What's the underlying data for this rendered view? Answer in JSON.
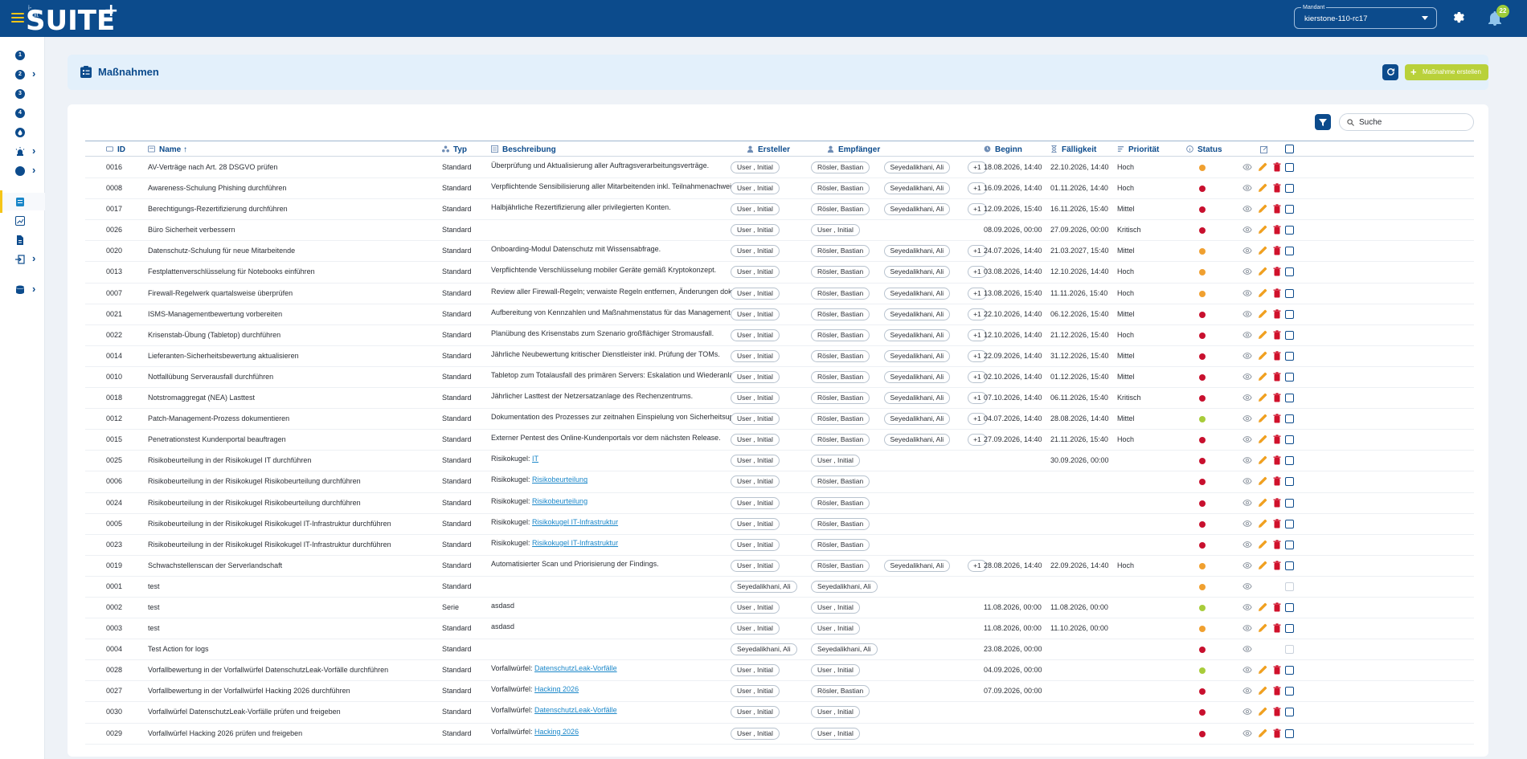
{
  "app": {
    "logo_small": "i-doit",
    "logo_text": "SUITE",
    "logo_plus": "+",
    "mandant_label": "Mandant",
    "mandant_value": "kierstone-110-rc17",
    "notification_count": "22"
  },
  "sidebar": {
    "items": [
      {
        "label": "1",
        "icon": "number-circle",
        "chevron": false
      },
      {
        "label": "2",
        "icon": "number-circle",
        "chevron": true
      },
      {
        "label": "3",
        "icon": "number-circle",
        "chevron": false
      },
      {
        "label": "4",
        "icon": "number-circle",
        "chevron": false
      },
      {
        "label": "",
        "icon": "flame-icon",
        "chevron": false
      },
      {
        "label": "",
        "icon": "alarm-light-icon",
        "chevron": true
      },
      {
        "label": "",
        "icon": "number-circle",
        "chevron": true
      },
      {
        "label": "",
        "icon": "clipboard-list-icon",
        "chevron": false,
        "active": true
      },
      {
        "label": "",
        "icon": "chart-icon",
        "chevron": false
      },
      {
        "label": "",
        "icon": "document-icon",
        "chevron": false
      },
      {
        "label": "",
        "icon": "login-icon",
        "chevron": true
      },
      {
        "label": "",
        "icon": "database-icon",
        "chevron": true
      }
    ]
  },
  "header": {
    "title": "Maßnahmen",
    "create_label": "Maßnahme erstellen"
  },
  "search": {
    "placeholder": "Suche"
  },
  "columns": {
    "id": "ID",
    "name": "Name",
    "name_sort": "↑",
    "typ": "Typ",
    "beschreibung": "Beschreibung",
    "ersteller": "Ersteller",
    "empfaenger": "Empfänger",
    "beginn": "Beginn",
    "faelligkeit": "Fälligkeit",
    "prioritaet": "Priorität",
    "status": "Status"
  },
  "colors": {
    "primary": "#0c4b8c",
    "accent": "#b9d13a",
    "status_red": "#c8102e",
    "status_orange": "#f0a030",
    "status_green": "#a8cc3a",
    "edit": "#f0a020",
    "delete": "#d0112b"
  },
  "rows": [
    {
      "id": "0016",
      "name": "AV-Verträge nach Art. 28 DSGVO prüfen",
      "typ": "Standard",
      "desc": "Überprüfung und Aktualisierung aller Auftragsverarbeitungsverträge.",
      "desc_link": "",
      "ersteller": "User , Initial",
      "empf": [
        "Rösler, Bastian",
        "Seyedalikhani, Ali",
        "+1"
      ],
      "beginn": "18.08.2026, 14:40",
      "faellig": "22.10.2026, 14:40",
      "prio": "Hoch",
      "status": "orange",
      "actions": "full"
    },
    {
      "id": "0008",
      "name": "Awareness-Schulung Phishing durchführen",
      "typ": "Standard",
      "desc": "Verpflichtende Sensibilisierung aller Mitarbeitenden inkl. Teilnahmenachweis.",
      "desc_link": "",
      "ersteller": "User , Initial",
      "empf": [
        "Rösler, Bastian",
        "Seyedalikhani, Ali",
        "+1"
      ],
      "beginn": "16.09.2026, 14:40",
      "faellig": "01.11.2026, 14:40",
      "prio": "Hoch",
      "status": "red",
      "actions": "full"
    },
    {
      "id": "0017",
      "name": "Berechtigungs-Rezertifizierung durchführen",
      "typ": "Standard",
      "desc": "Halbjährliche Rezertifizierung aller privilegierten Konten.",
      "desc_link": "",
      "ersteller": "User , Initial",
      "empf": [
        "Rösler, Bastian",
        "Seyedalikhani, Ali",
        "+1"
      ],
      "beginn": "12.09.2026, 15:40",
      "faellig": "16.11.2026, 15:40",
      "prio": "Mittel",
      "status": "red",
      "actions": "full"
    },
    {
      "id": "0026",
      "name": "Büro Sicherheit verbessern",
      "typ": "Standard",
      "desc": "",
      "desc_link": "",
      "ersteller": "User , Initial",
      "empf": [
        "User , Initial"
      ],
      "beginn": "08.09.2026, 00:00",
      "faellig": "27.09.2026, 00:00",
      "prio": "Kritisch",
      "status": "red",
      "actions": "full"
    },
    {
      "id": "0020",
      "name": "Datenschutz-Schulung für neue Mitarbeitende",
      "typ": "Standard",
      "desc": "Onboarding-Modul Datenschutz mit Wissensabfrage.",
      "desc_link": "",
      "ersteller": "User , Initial",
      "empf": [
        "Rösler, Bastian",
        "Seyedalikhani, Ali",
        "+1"
      ],
      "beginn": "24.07.2026, 14:40",
      "faellig": "21.03.2027, 15:40",
      "prio": "Mittel",
      "status": "orange",
      "actions": "full"
    },
    {
      "id": "0013",
      "name": "Festplattenverschlüsselung für Notebooks einführen",
      "typ": "Standard",
      "desc": "Verpflichtende Verschlüsselung mobiler Geräte gemäß Kryptokonzept.",
      "desc_link": "",
      "ersteller": "User , Initial",
      "empf": [
        "Rösler, Bastian",
        "Seyedalikhani, Ali",
        "+1"
      ],
      "beginn": "03.08.2026, 14:40",
      "faellig": "12.10.2026, 14:40",
      "prio": "Hoch",
      "status": "orange",
      "actions": "full"
    },
    {
      "id": "0007",
      "name": "Firewall-Regelwerk quartalsweise überprüfen",
      "typ": "Standard",
      "desc": "Review aller Firewall-Regeln; verwaiste Regeln entfernen, Änderungen dokumentieren.",
      "desc_link": "",
      "ersteller": "User , Initial",
      "empf": [
        "Rösler, Bastian",
        "Seyedalikhani, Ali",
        "+1"
      ],
      "beginn": "13.08.2026, 15:40",
      "faellig": "11.11.2026, 15:40",
      "prio": "Hoch",
      "status": "orange",
      "actions": "full"
    },
    {
      "id": "0021",
      "name": "ISMS-Managementbewertung vorbereiten",
      "typ": "Standard",
      "desc": "Aufbereitung von Kennzahlen und Maßnahmenstatus für das Management-Review.",
      "desc_link": "",
      "ersteller": "User , Initial",
      "empf": [
        "Rösler, Bastian",
        "Seyedalikhani, Ali",
        "+1"
      ],
      "beginn": "22.10.2026, 14:40",
      "faellig": "06.12.2026, 15:40",
      "prio": "Mittel",
      "status": "red",
      "actions": "full"
    },
    {
      "id": "0022",
      "name": "Krisenstab-Übung (Tabletop) durchführen",
      "typ": "Standard",
      "desc": "Planübung des Krisenstabs zum Szenario großflächiger Stromausfall.",
      "desc_link": "",
      "ersteller": "User , Initial",
      "empf": [
        "Rösler, Bastian",
        "Seyedalikhani, Ali",
        "+1"
      ],
      "beginn": "12.10.2026, 14:40",
      "faellig": "21.12.2026, 15:40",
      "prio": "Hoch",
      "status": "red",
      "actions": "full"
    },
    {
      "id": "0014",
      "name": "Lieferanten-Sicherheitsbewertung aktualisieren",
      "typ": "Standard",
      "desc": "Jährliche Neubewertung kritischer Dienstleister inkl. Prüfung der TOMs.",
      "desc_link": "",
      "ersteller": "User , Initial",
      "empf": [
        "Rösler, Bastian",
        "Seyedalikhani, Ali",
        "+1"
      ],
      "beginn": "22.09.2026, 14:40",
      "faellig": "31.12.2026, 15:40",
      "prio": "Mittel",
      "status": "red",
      "actions": "full"
    },
    {
      "id": "0010",
      "name": "Notfallübung Serverausfall durchführen",
      "typ": "Standard",
      "desc": "Tabletop zum Totalausfall des primären Servers: Eskalation und Wiederanlauf.",
      "desc_link": "",
      "ersteller": "User , Initial",
      "empf": [
        "Rösler, Bastian",
        "Seyedalikhani, Ali",
        "+1"
      ],
      "beginn": "02.10.2026, 14:40",
      "faellig": "01.12.2026, 15:40",
      "prio": "Mittel",
      "status": "red",
      "actions": "full"
    },
    {
      "id": "0018",
      "name": "Notstromaggregat (NEA) Lasttest",
      "typ": "Standard",
      "desc": "Jährlicher Lasttest der Netzersatzanlage des Rechenzentrums.",
      "desc_link": "",
      "ersteller": "User , Initial",
      "empf": [
        "Rösler, Bastian",
        "Seyedalikhani, Ali",
        "+1"
      ],
      "beginn": "07.10.2026, 14:40",
      "faellig": "06.11.2026, 15:40",
      "prio": "Kritisch",
      "status": "red",
      "actions": "full"
    },
    {
      "id": "0012",
      "name": "Patch-Management-Prozess dokumentieren",
      "typ": "Standard",
      "desc": "Dokumentation des Prozesses zur zeitnahen Einspielung von Sicherheitsupdates.",
      "desc_link": "",
      "ersteller": "User , Initial",
      "empf": [
        "Rösler, Bastian",
        "Seyedalikhani, Ali",
        "+1"
      ],
      "beginn": "04.07.2026, 14:40",
      "faellig": "28.08.2026, 14:40",
      "prio": "Mittel",
      "status": "green",
      "actions": "full"
    },
    {
      "id": "0015",
      "name": "Penetrationstest Kundenportal beauftragen",
      "typ": "Standard",
      "desc": "Externer Pentest des Online-Kundenportals vor dem nächsten Release.",
      "desc_link": "",
      "ersteller": "User , Initial",
      "empf": [
        "Rösler, Bastian",
        "Seyedalikhani, Ali",
        "+1"
      ],
      "beginn": "27.09.2026, 14:40",
      "faellig": "21.11.2026, 15:40",
      "prio": "Hoch",
      "status": "red",
      "actions": "full"
    },
    {
      "id": "0025",
      "name": "Risikobeurteilung in der Risikokugel IT durchführen",
      "typ": "Standard",
      "desc": "Risikokugel: ",
      "desc_link": "IT",
      "ersteller": "User , Initial",
      "empf": [
        "User , Initial"
      ],
      "beginn": "",
      "faellig": "30.09.2026, 00:00",
      "prio": "",
      "status": "red",
      "actions": "full"
    },
    {
      "id": "0006",
      "name": "Risikobeurteilung in der Risikokugel Risikobeurteilung durchführen",
      "typ": "Standard",
      "desc": "Risikokugel: ",
      "desc_link": "Risikobeurteilung",
      "ersteller": "User , Initial",
      "empf": [
        "Rösler, Bastian"
      ],
      "beginn": "",
      "faellig": "",
      "prio": "",
      "status": "red",
      "actions": "full"
    },
    {
      "id": "0024",
      "name": "Risikobeurteilung in der Risikokugel Risikobeurteilung durchführen",
      "typ": "Standard",
      "desc": "Risikokugel: ",
      "desc_link": "Risikobeurteilung",
      "ersteller": "User , Initial",
      "empf": [
        "Rösler, Bastian"
      ],
      "beginn": "",
      "faellig": "",
      "prio": "",
      "status": "red",
      "actions": "full"
    },
    {
      "id": "0005",
      "name": "Risikobeurteilung in der Risikokugel Risikokugel IT-Infrastruktur durchführen",
      "typ": "Standard",
      "desc": "Risikokugel: ",
      "desc_link": "Risikokugel IT-Infrastruktur",
      "ersteller": "User , Initial",
      "empf": [
        "Rösler, Bastian"
      ],
      "beginn": "",
      "faellig": "",
      "prio": "",
      "status": "red",
      "actions": "full"
    },
    {
      "id": "0023",
      "name": "Risikobeurteilung in der Risikokugel Risikokugel IT-Infrastruktur durchführen",
      "typ": "Standard",
      "desc": "Risikokugel: ",
      "desc_link": "Risikokugel IT-Infrastruktur",
      "ersteller": "User , Initial",
      "empf": [
        "Rösler, Bastian"
      ],
      "beginn": "",
      "faellig": "",
      "prio": "",
      "status": "red",
      "actions": "full"
    },
    {
      "id": "0019",
      "name": "Schwachstellenscan der Serverlandschaft",
      "typ": "Standard",
      "desc": "Automatisierter Scan und Priorisierung der Findings.",
      "desc_link": "",
      "ersteller": "User , Initial",
      "empf": [
        "Rösler, Bastian",
        "Seyedalikhani, Ali",
        "+1"
      ],
      "beginn": "28.08.2026, 14:40",
      "faellig": "22.09.2026, 14:40",
      "prio": "Hoch",
      "status": "orange",
      "actions": "full"
    },
    {
      "id": "0001",
      "name": "test",
      "typ": "Standard",
      "desc": "",
      "desc_link": "",
      "ersteller": "Seyedalikhani, Ali",
      "empf": [
        "Seyedalikhani, Ali"
      ],
      "beginn": "",
      "faellig": "",
      "prio": "",
      "status": "orange",
      "actions": "view"
    },
    {
      "id": "0002",
      "name": "test",
      "typ": "Serie",
      "desc": "asdasd",
      "desc_link": "",
      "ersteller": "User , Initial",
      "empf": [
        "User , Initial"
      ],
      "beginn": "11.08.2026, 00:00",
      "faellig": "11.08.2026, 00:00",
      "prio": "",
      "status": "green",
      "actions": "full"
    },
    {
      "id": "0003",
      "name": "test",
      "typ": "Standard",
      "desc": "asdasd",
      "desc_link": "",
      "ersteller": "User , Initial",
      "empf": [
        "User , Initial"
      ],
      "beginn": "11.08.2026, 00:00",
      "faellig": "11.10.2026, 00:00",
      "prio": "",
      "status": "orange",
      "actions": "full"
    },
    {
      "id": "0004",
      "name": "Test Action for logs",
      "typ": "Standard",
      "desc": "",
      "desc_link": "",
      "ersteller": "Seyedalikhani, Ali",
      "empf": [
        "Seyedalikhani, Ali"
      ],
      "beginn": "23.08.2026, 00:00",
      "faellig": "",
      "prio": "",
      "status": "red",
      "actions": "view"
    },
    {
      "id": "0028",
      "name": "Vorfallbewertung in der Vorfallwürfel DatenschutzLeak-Vorfälle durchführen",
      "typ": "Standard",
      "desc": "Vorfallwürfel: ",
      "desc_link": "DatenschutzLeak-Vorfälle",
      "ersteller": "User , Initial",
      "empf": [
        "User , Initial"
      ],
      "beginn": "04.09.2026, 00:00",
      "faellig": "",
      "prio": "",
      "status": "green",
      "actions": "full"
    },
    {
      "id": "0027",
      "name": "Vorfallbewertung in der Vorfallwürfel Hacking 2026 durchführen",
      "typ": "Standard",
      "desc": "Vorfallwürfel: ",
      "desc_link": "Hacking 2026",
      "ersteller": "User , Initial",
      "empf": [
        "Rösler, Bastian"
      ],
      "beginn": "07.09.2026, 00:00",
      "faellig": "",
      "prio": "",
      "status": "red",
      "actions": "full"
    },
    {
      "id": "0030",
      "name": "Vorfallwürfel DatenschutzLeak-Vorfälle prüfen und freigeben",
      "typ": "Standard",
      "desc": "Vorfallwürfel: ",
      "desc_link": "DatenschutzLeak-Vorfälle",
      "ersteller": "User , Initial",
      "empf": [
        "User , Initial"
      ],
      "beginn": "",
      "faellig": "",
      "prio": "",
      "status": "red",
      "actions": "full"
    },
    {
      "id": "0029",
      "name": "Vorfallwürfel Hacking 2026 prüfen und freigeben",
      "typ": "Standard",
      "desc": "Vorfallwürfel: ",
      "desc_link": "Hacking 2026",
      "ersteller": "User , Initial",
      "empf": [
        "User , Initial"
      ],
      "beginn": "",
      "faellig": "",
      "prio": "",
      "status": "red",
      "actions": "full"
    }
  ]
}
